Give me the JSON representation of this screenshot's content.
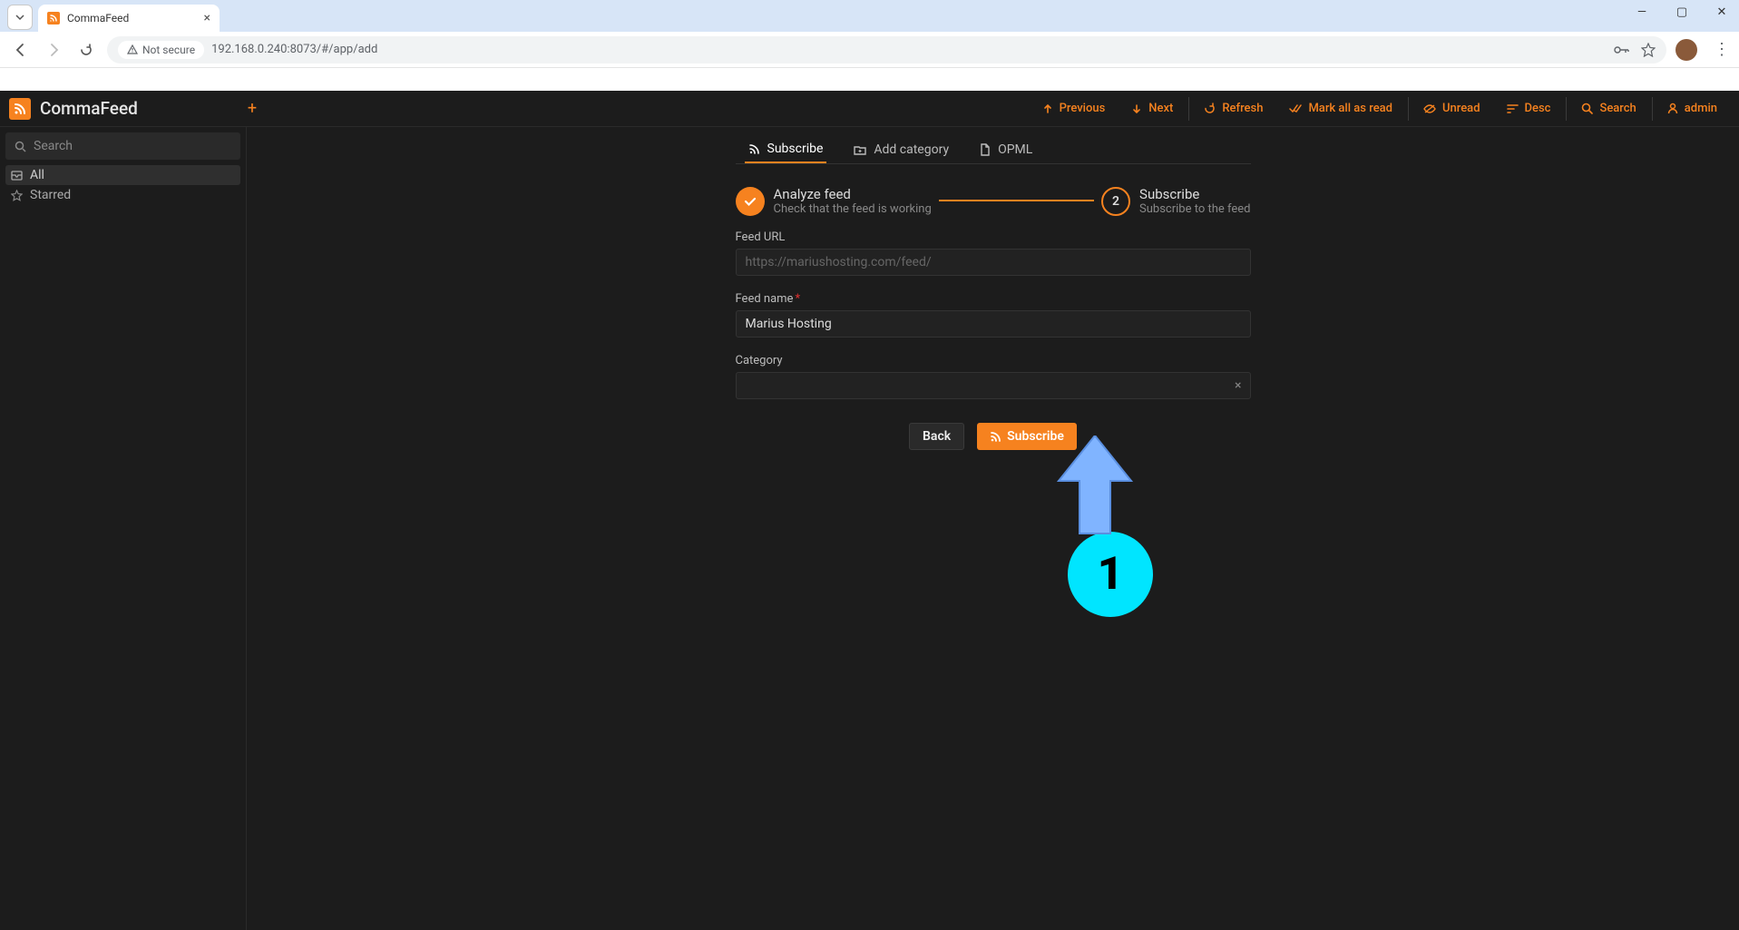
{
  "browser": {
    "tab_title": "CommaFeed",
    "url": "192.168.0.240:8073/#/app/add",
    "not_secure": "Not secure"
  },
  "app": {
    "brand": "CommaFeed",
    "sidebar": {
      "search_placeholder": "Search",
      "items": [
        {
          "label": "All",
          "active": true
        },
        {
          "label": "Starred",
          "active": false
        }
      ]
    },
    "top_actions": {
      "previous": "Previous",
      "next": "Next",
      "refresh": "Refresh",
      "mark_all": "Mark all as read",
      "unread": "Unread",
      "desc": "Desc",
      "search": "Search",
      "admin": "admin"
    },
    "tabs": {
      "subscribe": "Subscribe",
      "add_category": "Add category",
      "opml": "OPML"
    },
    "stepper": {
      "step1_title": "Analyze feed",
      "step1_desc": "Check that the feed is working",
      "step2_num": "2",
      "step2_title": "Subscribe",
      "step2_desc": "Subscribe to the feed"
    },
    "form": {
      "feed_url_label": "Feed URL",
      "feed_url_value": "https://mariushosting.com/feed/",
      "feed_name_label": "Feed name",
      "feed_name_value": "Marius Hosting",
      "category_label": "Category",
      "category_value": ""
    },
    "buttons": {
      "back": "Back",
      "subscribe": "Subscribe"
    }
  },
  "annotation": {
    "badge": "1"
  }
}
